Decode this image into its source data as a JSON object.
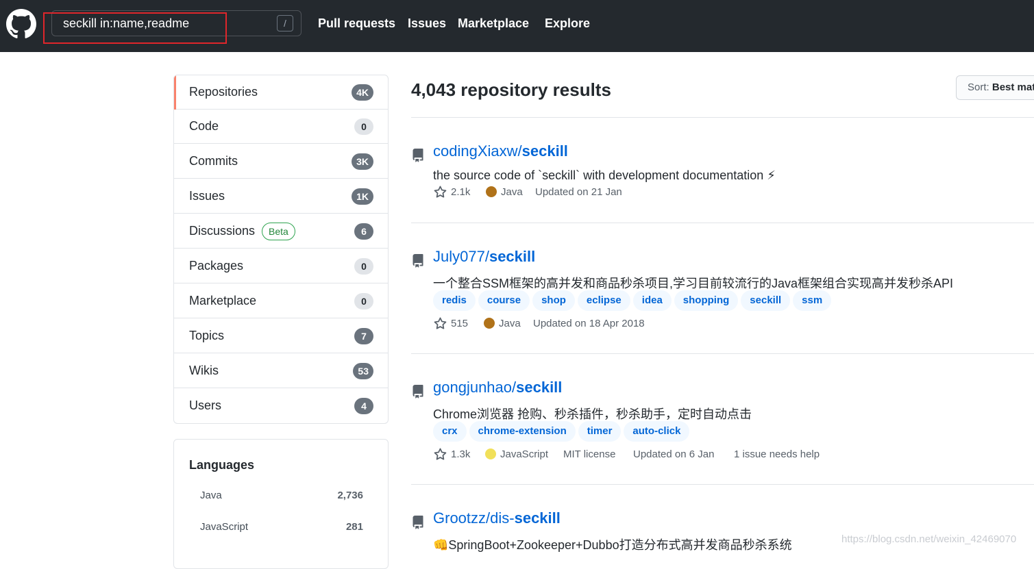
{
  "header": {
    "search_value": "seckill in:name,readme",
    "slash_hint": "/",
    "nav": [
      "Pull requests",
      "Issues",
      "Marketplace",
      "Explore"
    ]
  },
  "sidebar": {
    "items": [
      {
        "label": "Repositories",
        "count": "4K",
        "selected": true
      },
      {
        "label": "Code",
        "count": "0"
      },
      {
        "label": "Commits",
        "count": "3K"
      },
      {
        "label": "Issues",
        "count": "1K"
      },
      {
        "label": "Discussions",
        "count": "6",
        "badge": "Beta"
      },
      {
        "label": "Packages",
        "count": "0"
      },
      {
        "label": "Marketplace",
        "count": "0"
      },
      {
        "label": "Topics",
        "count": "7"
      },
      {
        "label": "Wikis",
        "count": "53"
      },
      {
        "label": "Users",
        "count": "4"
      }
    ],
    "languages": {
      "title": "Languages",
      "items": [
        {
          "name": "Java",
          "count": "2,736"
        },
        {
          "name": "JavaScript",
          "count": "281"
        }
      ]
    }
  },
  "results": {
    "title": "4,043 repository results",
    "sort_label": "Sort:",
    "sort_value": "Best match",
    "repos": [
      {
        "owner": "codingXiaxw/",
        "name": "seckill",
        "description": "the source code of `seckill` with development documentation ⚡",
        "topics": [],
        "stars": "2.1k",
        "language": "Java",
        "language_color": "#b07219",
        "license": "",
        "updated": "Updated on 21 Jan",
        "issues": ""
      },
      {
        "owner": "July077/",
        "name": "seckill",
        "description": "一个整合SSM框架的高并发和商品秒杀项目,学习目前较流行的Java框架组合实现高并发秒杀API",
        "topics": [
          "redis",
          "course",
          "shop",
          "eclipse",
          "idea",
          "shopping",
          "seckill",
          "ssm"
        ],
        "stars": "515",
        "language": "Java",
        "language_color": "#b07219",
        "license": "",
        "updated": "Updated on 18 Apr 2018",
        "issues": ""
      },
      {
        "owner": "gongjunhao/",
        "name": "seckill",
        "description": "Chrome浏览器 抢购、秒杀插件，秒杀助手，定时自动点击",
        "topics": [
          "crx",
          "chrome-extension",
          "timer",
          "auto-click"
        ],
        "stars": "1.3k",
        "language": "JavaScript",
        "language_color": "#f1e05a",
        "license": "MIT license",
        "updated": "Updated on 6 Jan",
        "issues": "1 issue needs help"
      },
      {
        "owner": "Grootzz/dis-",
        "name": "seckill",
        "description": "👊SpringBoot+Zookeeper+Dubbo打造分布式高并发商品秒杀系统",
        "topics": [],
        "stars": "",
        "language": "",
        "language_color": "",
        "license": "",
        "updated": "",
        "issues": ""
      }
    ]
  },
  "watermark": "https://blog.csdn.net/weixin_42469070",
  "colors": {
    "header_bg": "#24292e",
    "link": "#0366d6",
    "selected_accent": "#f9826c",
    "highlight_box": "#e0262b"
  }
}
